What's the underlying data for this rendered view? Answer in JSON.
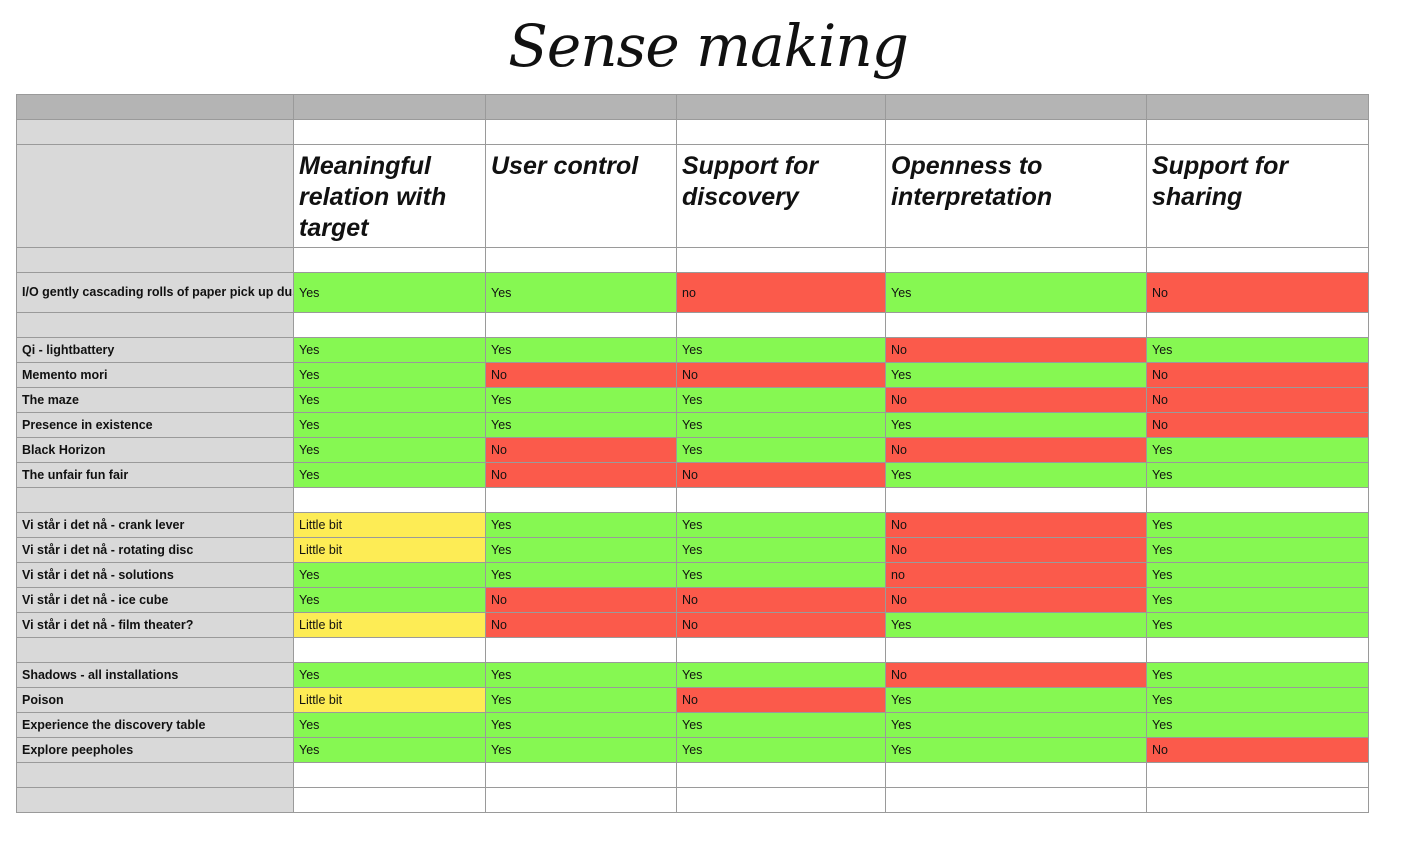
{
  "title": "Sense making",
  "columns": [
    "Meaningful relation with target",
    "User control",
    "Support for discovery",
    "Openness to interpretation",
    "Support for sharing"
  ],
  "groups": [
    {
      "rows": [
        {
          "label": "I/O gently cascading rolls of paper pick up dust and other debris",
          "values": [
            "Yes",
            "Yes",
            "no",
            "Yes",
            "No"
          ]
        }
      ]
    },
    {
      "rows": [
        {
          "label": "Qi - lightbattery",
          "values": [
            "Yes",
            "Yes",
            "Yes",
            "No",
            "Yes"
          ]
        },
        {
          "label": "Memento mori",
          "values": [
            "Yes",
            "No",
            "No",
            "Yes",
            "No"
          ]
        },
        {
          "label": "The maze",
          "values": [
            "Yes",
            "Yes",
            "Yes",
            "No",
            "No"
          ]
        },
        {
          "label": "Presence in existence",
          "values": [
            "Yes",
            "Yes",
            "Yes",
            "Yes",
            "No"
          ]
        },
        {
          "label": "Black Horizon",
          "values": [
            "Yes",
            "No",
            "Yes",
            "No",
            "Yes"
          ]
        },
        {
          "label": "The unfair fun fair",
          "values": [
            "Yes",
            "No",
            "No",
            "Yes",
            "Yes"
          ]
        }
      ]
    },
    {
      "rows": [
        {
          "label": "Vi står i det nå - crank lever",
          "values": [
            "Little bit",
            "Yes",
            "Yes",
            "No",
            "Yes"
          ]
        },
        {
          "label": "Vi står i det nå  - rotating disc",
          "values": [
            "Little bit",
            "Yes",
            "Yes",
            "No",
            "Yes"
          ]
        },
        {
          "label": "Vi står i det nå - solutions",
          "values": [
            "Yes",
            "Yes",
            "Yes",
            "no",
            "Yes"
          ]
        },
        {
          "label": "Vi står i det nå - ice cube",
          "values": [
            "Yes",
            "No",
            "No",
            "No",
            "Yes"
          ]
        },
        {
          "label": "Vi står i det nå - film theater?",
          "values": [
            "Little bit",
            "No",
            "No",
            "Yes",
            "Yes"
          ]
        }
      ]
    },
    {
      "rows": [
        {
          "label": "Shadows - all installations",
          "values": [
            "Yes",
            "Yes",
            "Yes",
            "No",
            "Yes"
          ]
        },
        {
          "label": "Poison",
          "values": [
            "Little bit",
            "Yes",
            "No",
            "Yes",
            "Yes"
          ]
        },
        {
          "label": "Experience the discovery table",
          "values": [
            "Yes",
            "Yes",
            "Yes",
            "Yes",
            "Yes"
          ]
        },
        {
          "label": "Explore peepholes",
          "values": [
            "Yes",
            "Yes",
            "Yes",
            "Yes",
            "No"
          ]
        }
      ]
    }
  ],
  "colors": {
    "yes": "#86f852",
    "no": "#fb5a4b",
    "partial": "#fdec55",
    "header_bar": "#b4b4b4",
    "row_header": "#d9d9d9"
  }
}
